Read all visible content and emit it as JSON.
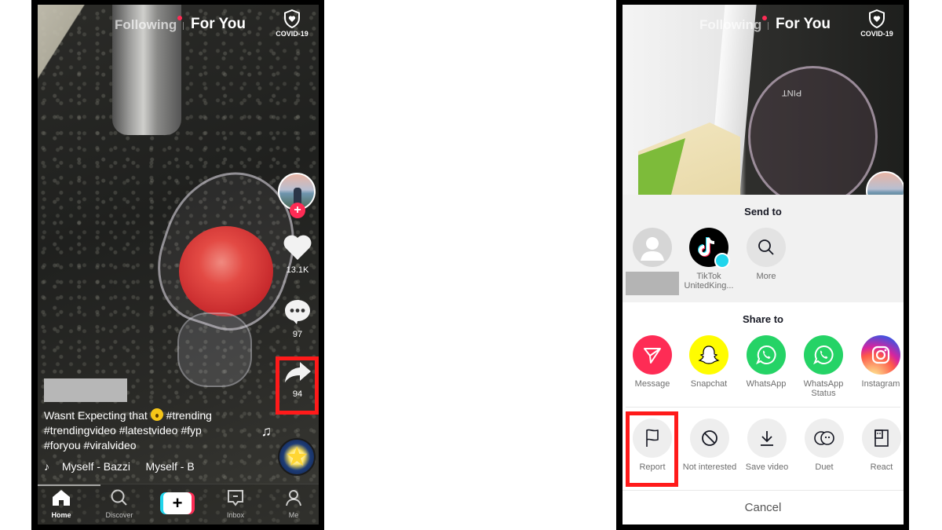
{
  "left_screen": {
    "top_tabs": {
      "following": "Following",
      "for_you": "For You"
    },
    "covid_label": "COVID-19",
    "rail": {
      "likes": "13.1K",
      "comments": "97",
      "shares": "94"
    },
    "caption": {
      "text_line1": "Wasnt Expecting that",
      "tags_line1": "#trending",
      "text_line2": "#trendingvideo #latestvideo #fyp",
      "text_line3": "#foryou #viralvideo"
    },
    "music": "Myself - Bazzi     Myself - B",
    "nav": {
      "home": "Home",
      "discover": "Discover",
      "create": "+",
      "inbox": "Inbox",
      "me": "Me"
    }
  },
  "right_screen": {
    "top_tabs": {
      "following": "Following",
      "for_you": "For You"
    },
    "covid_label": "COVID-19",
    "video_text": "PINT",
    "sheet": {
      "send_title": "Send to",
      "send_items": [
        {
          "label": ""
        },
        {
          "label": "TikTok UnitedKing..."
        },
        {
          "label": "More"
        }
      ],
      "share_title": "Share to",
      "share_items": [
        {
          "label": "Message",
          "color": "#fe2c55"
        },
        {
          "label": "Snapchat",
          "color": "#fffc00"
        },
        {
          "label": "WhatsApp",
          "color": "#25d366"
        },
        {
          "label": "WhatsApp Status",
          "color": "#25d366"
        },
        {
          "label": "Instagram",
          "color": "#c13584"
        }
      ],
      "actions": [
        {
          "label": "Report"
        },
        {
          "label": "Not interested"
        },
        {
          "label": "Save video"
        },
        {
          "label": "Duet"
        },
        {
          "label": "React"
        }
      ],
      "cancel": "Cancel"
    }
  },
  "highlight_color": "#ff1a1a"
}
